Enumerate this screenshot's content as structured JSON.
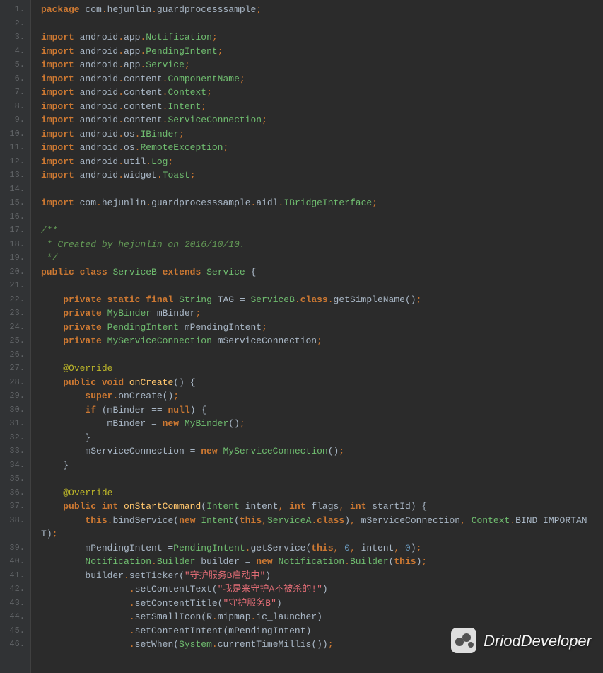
{
  "watermark": {
    "text": "DriodDeveloper"
  },
  "lines": [
    {
      "n": "1.",
      "tokens": [
        [
          "kw",
          "package"
        ],
        [
          "norm",
          " com"
        ],
        [
          "punct",
          "."
        ],
        [
          "norm",
          "hejunlin"
        ],
        [
          "punct",
          "."
        ],
        [
          "norm",
          "guardprocesssample"
        ],
        [
          "punct",
          ";"
        ]
      ]
    },
    {
      "n": "2.",
      "tokens": []
    },
    {
      "n": "3.",
      "tokens": [
        [
          "kw",
          "import"
        ],
        [
          "norm",
          " android"
        ],
        [
          "punct",
          "."
        ],
        [
          "norm",
          "app"
        ],
        [
          "punct",
          "."
        ],
        [
          "cls",
          "Notification"
        ],
        [
          "punct",
          ";"
        ]
      ]
    },
    {
      "n": "4.",
      "tokens": [
        [
          "kw",
          "import"
        ],
        [
          "norm",
          " android"
        ],
        [
          "punct",
          "."
        ],
        [
          "norm",
          "app"
        ],
        [
          "punct",
          "."
        ],
        [
          "cls",
          "PendingIntent"
        ],
        [
          "punct",
          ";"
        ]
      ]
    },
    {
      "n": "5.",
      "tokens": [
        [
          "kw",
          "import"
        ],
        [
          "norm",
          " android"
        ],
        [
          "punct",
          "."
        ],
        [
          "norm",
          "app"
        ],
        [
          "punct",
          "."
        ],
        [
          "cls",
          "Service"
        ],
        [
          "punct",
          ";"
        ]
      ]
    },
    {
      "n": "6.",
      "tokens": [
        [
          "kw",
          "import"
        ],
        [
          "norm",
          " android"
        ],
        [
          "punct",
          "."
        ],
        [
          "norm",
          "content"
        ],
        [
          "punct",
          "."
        ],
        [
          "cls",
          "ComponentName"
        ],
        [
          "punct",
          ";"
        ]
      ]
    },
    {
      "n": "7.",
      "tokens": [
        [
          "kw",
          "import"
        ],
        [
          "norm",
          " android"
        ],
        [
          "punct",
          "."
        ],
        [
          "norm",
          "content"
        ],
        [
          "punct",
          "."
        ],
        [
          "cls",
          "Context"
        ],
        [
          "punct",
          ";"
        ]
      ]
    },
    {
      "n": "8.",
      "tokens": [
        [
          "kw",
          "import"
        ],
        [
          "norm",
          " android"
        ],
        [
          "punct",
          "."
        ],
        [
          "norm",
          "content"
        ],
        [
          "punct",
          "."
        ],
        [
          "cls",
          "Intent"
        ],
        [
          "punct",
          ";"
        ]
      ]
    },
    {
      "n": "9.",
      "tokens": [
        [
          "kw",
          "import"
        ],
        [
          "norm",
          " android"
        ],
        [
          "punct",
          "."
        ],
        [
          "norm",
          "content"
        ],
        [
          "punct",
          "."
        ],
        [
          "cls",
          "ServiceConnection"
        ],
        [
          "punct",
          ";"
        ]
      ]
    },
    {
      "n": "10.",
      "tokens": [
        [
          "kw",
          "import"
        ],
        [
          "norm",
          " android"
        ],
        [
          "punct",
          "."
        ],
        [
          "norm",
          "os"
        ],
        [
          "punct",
          "."
        ],
        [
          "cls",
          "IBinder"
        ],
        [
          "punct",
          ";"
        ]
      ]
    },
    {
      "n": "11.",
      "tokens": [
        [
          "kw",
          "import"
        ],
        [
          "norm",
          " android"
        ],
        [
          "punct",
          "."
        ],
        [
          "norm",
          "os"
        ],
        [
          "punct",
          "."
        ],
        [
          "cls",
          "RemoteException"
        ],
        [
          "punct",
          ";"
        ]
      ]
    },
    {
      "n": "12.",
      "tokens": [
        [
          "kw",
          "import"
        ],
        [
          "norm",
          " android"
        ],
        [
          "punct",
          "."
        ],
        [
          "norm",
          "util"
        ],
        [
          "punct",
          "."
        ],
        [
          "cls",
          "Log"
        ],
        [
          "punct",
          ";"
        ]
      ]
    },
    {
      "n": "13.",
      "tokens": [
        [
          "kw",
          "import"
        ],
        [
          "norm",
          " android"
        ],
        [
          "punct",
          "."
        ],
        [
          "norm",
          "widget"
        ],
        [
          "punct",
          "."
        ],
        [
          "cls",
          "Toast"
        ],
        [
          "punct",
          ";"
        ]
      ]
    },
    {
      "n": "14.",
      "tokens": []
    },
    {
      "n": "15.",
      "tokens": [
        [
          "kw",
          "import"
        ],
        [
          "norm",
          " com"
        ],
        [
          "punct",
          "."
        ],
        [
          "norm",
          "hejunlin"
        ],
        [
          "punct",
          "."
        ],
        [
          "norm",
          "guardprocesssample"
        ],
        [
          "punct",
          "."
        ],
        [
          "norm",
          "aidl"
        ],
        [
          "punct",
          "."
        ],
        [
          "cls",
          "IBridgeInterface"
        ],
        [
          "punct",
          ";"
        ]
      ]
    },
    {
      "n": "16.",
      "tokens": []
    },
    {
      "n": "17.",
      "tokens": [
        [
          "cmt",
          "/**"
        ]
      ]
    },
    {
      "n": "18.",
      "tokens": [
        [
          "cmt",
          " * Created by hejunlin on 2016/10/10."
        ]
      ]
    },
    {
      "n": "19.",
      "tokens": [
        [
          "cmt",
          " */"
        ]
      ]
    },
    {
      "n": "20.",
      "tokens": [
        [
          "kw",
          "public class"
        ],
        [
          "norm",
          " "
        ],
        [
          "cls",
          "ServiceB"
        ],
        [
          "norm",
          " "
        ],
        [
          "kw",
          "extends"
        ],
        [
          "norm",
          " "
        ],
        [
          "cls",
          "Service"
        ],
        [
          "norm",
          " {"
        ]
      ]
    },
    {
      "n": "21.",
      "tokens": []
    },
    {
      "n": "22.",
      "tokens": [
        [
          "norm",
          "    "
        ],
        [
          "kw",
          "private static final"
        ],
        [
          "norm",
          " "
        ],
        [
          "cls",
          "String"
        ],
        [
          "norm",
          " TAG = "
        ],
        [
          "cls",
          "ServiceB"
        ],
        [
          "punct",
          "."
        ],
        [
          "kw",
          "class"
        ],
        [
          "punct",
          "."
        ],
        [
          "norm",
          "getSimpleName"
        ],
        [
          "paren",
          "()"
        ],
        [
          "punct",
          ";"
        ]
      ]
    },
    {
      "n": "23.",
      "tokens": [
        [
          "norm",
          "    "
        ],
        [
          "kw",
          "private"
        ],
        [
          "norm",
          " "
        ],
        [
          "cls",
          "MyBinder"
        ],
        [
          "norm",
          " mBinder"
        ],
        [
          "punct",
          ";"
        ]
      ]
    },
    {
      "n": "24.",
      "tokens": [
        [
          "norm",
          "    "
        ],
        [
          "kw",
          "private"
        ],
        [
          "norm",
          " "
        ],
        [
          "cls",
          "PendingIntent"
        ],
        [
          "norm",
          " mPendingIntent"
        ],
        [
          "punct",
          ";"
        ]
      ]
    },
    {
      "n": "25.",
      "tokens": [
        [
          "norm",
          "    "
        ],
        [
          "kw",
          "private"
        ],
        [
          "norm",
          " "
        ],
        [
          "cls",
          "MyServiceConnection"
        ],
        [
          "norm",
          " mServiceConnection"
        ],
        [
          "punct",
          ";"
        ]
      ]
    },
    {
      "n": "26.",
      "tokens": []
    },
    {
      "n": "27.",
      "tokens": [
        [
          "norm",
          "    "
        ],
        [
          "ann",
          "@Override"
        ]
      ]
    },
    {
      "n": "28.",
      "tokens": [
        [
          "norm",
          "    "
        ],
        [
          "kw",
          "public void"
        ],
        [
          "norm",
          " "
        ],
        [
          "method",
          "onCreate"
        ],
        [
          "paren",
          "()"
        ],
        [
          "norm",
          " {"
        ]
      ]
    },
    {
      "n": "29.",
      "tokens": [
        [
          "norm",
          "        "
        ],
        [
          "kw",
          "super"
        ],
        [
          "punct",
          "."
        ],
        [
          "norm",
          "onCreate"
        ],
        [
          "paren",
          "()"
        ],
        [
          "punct",
          ";"
        ]
      ]
    },
    {
      "n": "30.",
      "tokens": [
        [
          "norm",
          "        "
        ],
        [
          "kw",
          "if"
        ],
        [
          "norm",
          " "
        ],
        [
          "paren",
          "("
        ],
        [
          "norm",
          "mBinder == "
        ],
        [
          "kw",
          "null"
        ],
        [
          "paren",
          ")"
        ],
        [
          "norm",
          " {"
        ]
      ]
    },
    {
      "n": "31.",
      "tokens": [
        [
          "norm",
          "            mBinder = "
        ],
        [
          "kw",
          "new"
        ],
        [
          "norm",
          " "
        ],
        [
          "cls",
          "MyBinder"
        ],
        [
          "paren",
          "()"
        ],
        [
          "punct",
          ";"
        ]
      ]
    },
    {
      "n": "32.",
      "tokens": [
        [
          "norm",
          "        }"
        ]
      ]
    },
    {
      "n": "33.",
      "tokens": [
        [
          "norm",
          "        mServiceConnection = "
        ],
        [
          "kw",
          "new"
        ],
        [
          "norm",
          " "
        ],
        [
          "cls",
          "MyServiceConnection"
        ],
        [
          "paren",
          "()"
        ],
        [
          "punct",
          ";"
        ]
      ]
    },
    {
      "n": "34.",
      "tokens": [
        [
          "norm",
          "    }"
        ]
      ]
    },
    {
      "n": "35.",
      "tokens": []
    },
    {
      "n": "36.",
      "tokens": [
        [
          "norm",
          "    "
        ],
        [
          "ann",
          "@Override"
        ]
      ]
    },
    {
      "n": "37.",
      "tokens": [
        [
          "norm",
          "    "
        ],
        [
          "kw",
          "public int"
        ],
        [
          "norm",
          " "
        ],
        [
          "method",
          "onStartCommand"
        ],
        [
          "paren",
          "("
        ],
        [
          "cls",
          "Intent"
        ],
        [
          "norm",
          " intent"
        ],
        [
          "punct",
          ","
        ],
        [
          "norm",
          " "
        ],
        [
          "kw",
          "int"
        ],
        [
          "norm",
          " flags"
        ],
        [
          "punct",
          ","
        ],
        [
          "norm",
          " "
        ],
        [
          "kw",
          "int"
        ],
        [
          "norm",
          " startId"
        ],
        [
          "paren",
          ")"
        ],
        [
          "norm",
          " {"
        ]
      ]
    },
    {
      "n": "38.",
      "tokens": [
        [
          "norm",
          "        "
        ],
        [
          "kw",
          "this"
        ],
        [
          "punct",
          "."
        ],
        [
          "norm",
          "bindService"
        ],
        [
          "paren",
          "("
        ],
        [
          "kw",
          "new"
        ],
        [
          "norm",
          " "
        ],
        [
          "cls",
          "Intent"
        ],
        [
          "paren",
          "("
        ],
        [
          "kw",
          "this"
        ],
        [
          "punct",
          ","
        ],
        [
          "cls",
          "ServiceA"
        ],
        [
          "punct",
          "."
        ],
        [
          "kw",
          "class"
        ],
        [
          "paren",
          ")"
        ],
        [
          "punct",
          ","
        ],
        [
          "norm",
          " mServiceConnection"
        ],
        [
          "punct",
          ","
        ],
        [
          "norm",
          " "
        ],
        [
          "cls",
          "Context"
        ],
        [
          "punct",
          "."
        ],
        [
          "norm",
          "BIND_IMPORTAN"
        ]
      ]
    },
    {
      "n": "",
      "tokens": [
        [
          "norm",
          "T"
        ],
        [
          "paren",
          ")"
        ],
        [
          "punct",
          ";"
        ]
      ]
    },
    {
      "n": "39.",
      "tokens": [
        [
          "norm",
          "        mPendingIntent ="
        ],
        [
          "cls",
          "PendingIntent"
        ],
        [
          "punct",
          "."
        ],
        [
          "norm",
          "getService"
        ],
        [
          "paren",
          "("
        ],
        [
          "kw",
          "this"
        ],
        [
          "punct",
          ","
        ],
        [
          "norm",
          " "
        ],
        [
          "num",
          "0"
        ],
        [
          "punct",
          ","
        ],
        [
          "norm",
          " intent"
        ],
        [
          "punct",
          ","
        ],
        [
          "norm",
          " "
        ],
        [
          "num",
          "0"
        ],
        [
          "paren",
          ")"
        ],
        [
          "punct",
          ";"
        ]
      ]
    },
    {
      "n": "40.",
      "tokens": [
        [
          "norm",
          "        "
        ],
        [
          "cls",
          "Notification"
        ],
        [
          "punct",
          "."
        ],
        [
          "cls",
          "Builder"
        ],
        [
          "norm",
          " builder = "
        ],
        [
          "kw",
          "new"
        ],
        [
          "norm",
          " "
        ],
        [
          "cls",
          "Notification"
        ],
        [
          "punct",
          "."
        ],
        [
          "cls",
          "Builder"
        ],
        [
          "paren",
          "("
        ],
        [
          "kw",
          "this"
        ],
        [
          "paren",
          ")"
        ],
        [
          "punct",
          ";"
        ]
      ]
    },
    {
      "n": "41.",
      "tokens": [
        [
          "norm",
          "        builder"
        ],
        [
          "punct",
          "."
        ],
        [
          "norm",
          "setTicker"
        ],
        [
          "paren",
          "("
        ],
        [
          "str",
          "\"守护服务B启动中\""
        ],
        [
          "paren",
          ")"
        ]
      ]
    },
    {
      "n": "42.",
      "tokens": [
        [
          "norm",
          "                "
        ],
        [
          "punct",
          "."
        ],
        [
          "norm",
          "setContentText"
        ],
        [
          "paren",
          "("
        ],
        [
          "str",
          "\"我是来守护A不被杀的!\""
        ],
        [
          "paren",
          ")"
        ]
      ]
    },
    {
      "n": "43.",
      "tokens": [
        [
          "norm",
          "                "
        ],
        [
          "punct",
          "."
        ],
        [
          "norm",
          "setContentTitle"
        ],
        [
          "paren",
          "("
        ],
        [
          "str",
          "\"守护服务B\""
        ],
        [
          "paren",
          ")"
        ]
      ]
    },
    {
      "n": "44.",
      "tokens": [
        [
          "norm",
          "                "
        ],
        [
          "punct",
          "."
        ],
        [
          "norm",
          "setSmallIcon"
        ],
        [
          "paren",
          "("
        ],
        [
          "norm",
          "R"
        ],
        [
          "punct",
          "."
        ],
        [
          "norm",
          "mipmap"
        ],
        [
          "punct",
          "."
        ],
        [
          "norm",
          "ic_launcher"
        ],
        [
          "paren",
          ")"
        ]
      ]
    },
    {
      "n": "45.",
      "tokens": [
        [
          "norm",
          "                "
        ],
        [
          "punct",
          "."
        ],
        [
          "norm",
          "setContentIntent"
        ],
        [
          "paren",
          "("
        ],
        [
          "norm",
          "mPendingIntent"
        ],
        [
          "paren",
          ")"
        ]
      ]
    },
    {
      "n": "46.",
      "tokens": [
        [
          "norm",
          "                "
        ],
        [
          "punct",
          "."
        ],
        [
          "norm",
          "setWhen"
        ],
        [
          "paren",
          "("
        ],
        [
          "cls",
          "System"
        ],
        [
          "punct",
          "."
        ],
        [
          "norm",
          "currentTimeMillis"
        ],
        [
          "paren",
          "())"
        ],
        [
          "punct",
          ";"
        ]
      ]
    }
  ]
}
